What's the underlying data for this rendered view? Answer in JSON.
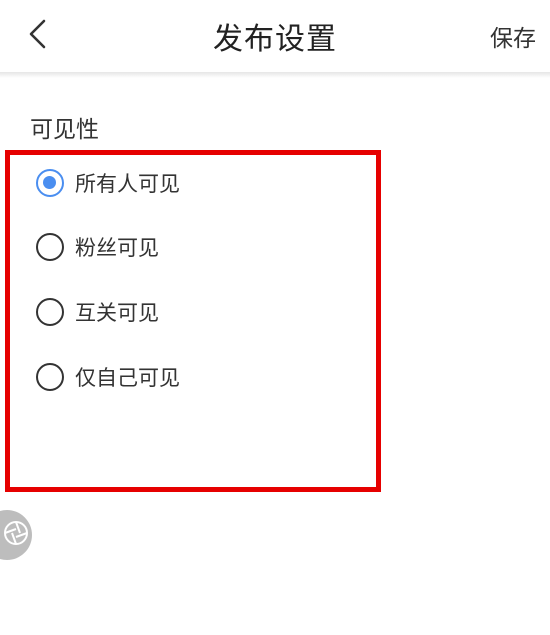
{
  "header": {
    "title": "发布设置",
    "save_label": "保存",
    "back_icon": "chevron-left-icon"
  },
  "visibility": {
    "section_title": "可见性",
    "options": [
      {
        "label": "所有人可见",
        "selected": true
      },
      {
        "label": "粉丝可见",
        "selected": false
      },
      {
        "label": "互关可见",
        "selected": false
      },
      {
        "label": "仅自己可见",
        "selected": false
      }
    ],
    "highlight_color": "#e60000",
    "accent_color": "#4a8ef0"
  },
  "floating_button": {
    "icon": "aperture-icon"
  }
}
